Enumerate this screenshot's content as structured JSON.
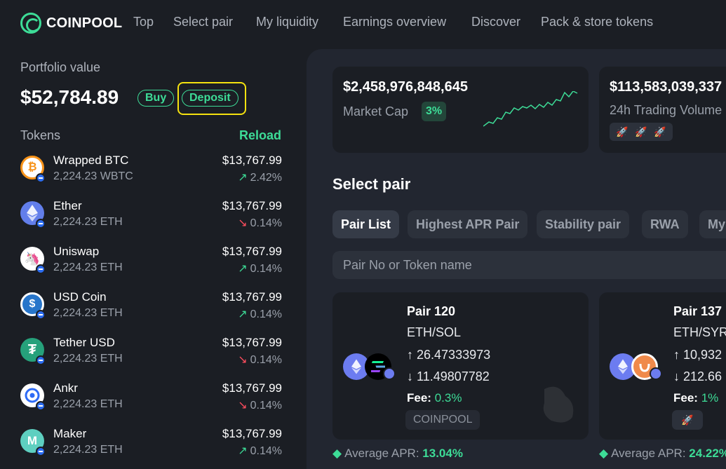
{
  "nav": {
    "logo_text": "COINPOOL",
    "links": [
      "Top",
      "Select pair",
      "My liquidity",
      "Earnings overview",
      "Discover",
      "Pack & store tokens"
    ]
  },
  "portfolio": {
    "label": "Portfolio value",
    "value": "$52,784.89",
    "buy_label": "Buy",
    "deposit_label": "Deposit"
  },
  "tokens": {
    "header": "Tokens",
    "reload_label": "Reload",
    "items": [
      {
        "name": "Wrapped BTC",
        "amount": "2,224.23 WBTC",
        "price": "$13,767.99",
        "change": "2.42%",
        "direction": "up",
        "icon": "bitcoin-icon",
        "color": "#f7931a"
      },
      {
        "name": "Ether",
        "amount": "2,224.23 ETH",
        "price": "$13,767.99",
        "change": "0.14%",
        "direction": "down",
        "icon": "ethereum-icon",
        "color": "#627eea"
      },
      {
        "name": "Uniswap",
        "amount": "2,224.23 ETH",
        "price": "$13,767.99",
        "change": "0.14%",
        "direction": "up",
        "icon": "uniswap-icon",
        "color": "#ff007a"
      },
      {
        "name": "USD Coin",
        "amount": "2,224.23 ETH",
        "price": "$13,767.99",
        "change": "0.14%",
        "direction": "up",
        "icon": "usdc-icon",
        "color": "#2775ca"
      },
      {
        "name": "Tether USD",
        "amount": "2,224.23 ETH",
        "price": "$13,767.99",
        "change": "0.14%",
        "direction": "down",
        "icon": "tether-icon",
        "color": "#26a17b"
      },
      {
        "name": "Ankr",
        "amount": "2,224.23 ETH",
        "price": "$13,767.99",
        "change": "0.14%",
        "direction": "down",
        "icon": "ankr-icon",
        "color": "#2e6bf6"
      },
      {
        "name": "Maker",
        "amount": "2,224.23 ETH",
        "price": "$13,767.99",
        "change": "0.14%",
        "direction": "up",
        "icon": "maker-icon",
        "color": "#1aab9b"
      }
    ]
  },
  "stats": [
    {
      "value": "$2,458,976,848,645",
      "label": "Market Cap",
      "chip": "3%"
    },
    {
      "value": "$113,583,039,337",
      "label": "24h Trading Volume"
    }
  ],
  "select_pair": {
    "title": "Select pair",
    "tabs": [
      "Pair List",
      "Highest APR Pair",
      "Stability pair",
      "RWA",
      "My"
    ],
    "search_placeholder": "Pair No or Token name"
  },
  "pairs": [
    {
      "title": "Pair 120",
      "name": "ETH/SOL",
      "up": "26.47333973",
      "down": "11.49807782",
      "fee_label": "Fee:",
      "fee": "0.3%",
      "tag": "COINPOOL",
      "apr_label": "Average APR:",
      "apr": "13.04%"
    },
    {
      "title": "Pair 137",
      "name": "ETH/SYRUP",
      "up": "10,932",
      "down": "212.66",
      "fee_label": "Fee:",
      "fee": "1%",
      "apr_label": "Average APR:",
      "apr": "24.22%"
    }
  ]
}
